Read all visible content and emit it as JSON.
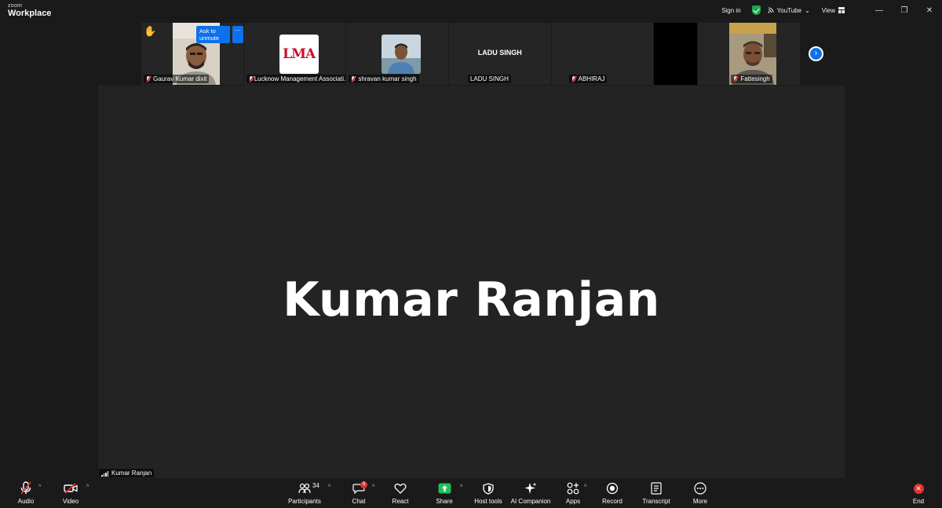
{
  "app": {
    "brand_small": "zoom",
    "brand_big": "Workplace"
  },
  "titlebar": {
    "sign_in": "Sign in",
    "youtube": "YouTube",
    "view": "View",
    "minimize": "—",
    "restore": "❐",
    "close": "✕"
  },
  "participants_strip": {
    "tiles": [
      {
        "name": "Gaurav Kumar dixit",
        "ask_to_unmute": "Ask to unmute",
        "more": "···"
      },
      {
        "name": "Lucknow Management Associati...",
        "logo_text": "LMA"
      },
      {
        "name": "shravan kumar singh"
      },
      {
        "name": "LADU SINGH",
        "center_text": "LADU SINGH"
      },
      {
        "name": "ABHIRAJ"
      },
      {
        "name": "Fattesingh"
      }
    ],
    "next_arrow": "›"
  },
  "stage": {
    "big_name": "Kumar Ranjan",
    "speaker_label": "Kumar Ranjan"
  },
  "toolbar": {
    "audio": "Audio",
    "video": "Video",
    "participants": "Participants",
    "participants_count": "34",
    "chat": "Chat",
    "chat_badge": "9",
    "react": "React",
    "share": "Share",
    "host_tools": "Host tools",
    "ai_companion": "AI Companion",
    "apps": "Apps",
    "record": "Record",
    "transcript": "Transcript",
    "more": "More",
    "end": "End"
  },
  "colors": {
    "accent_blue": "#0e71eb",
    "share_green": "#1fbf5a",
    "end_red": "#e0342f",
    "raise_hand": "#f5b400"
  }
}
